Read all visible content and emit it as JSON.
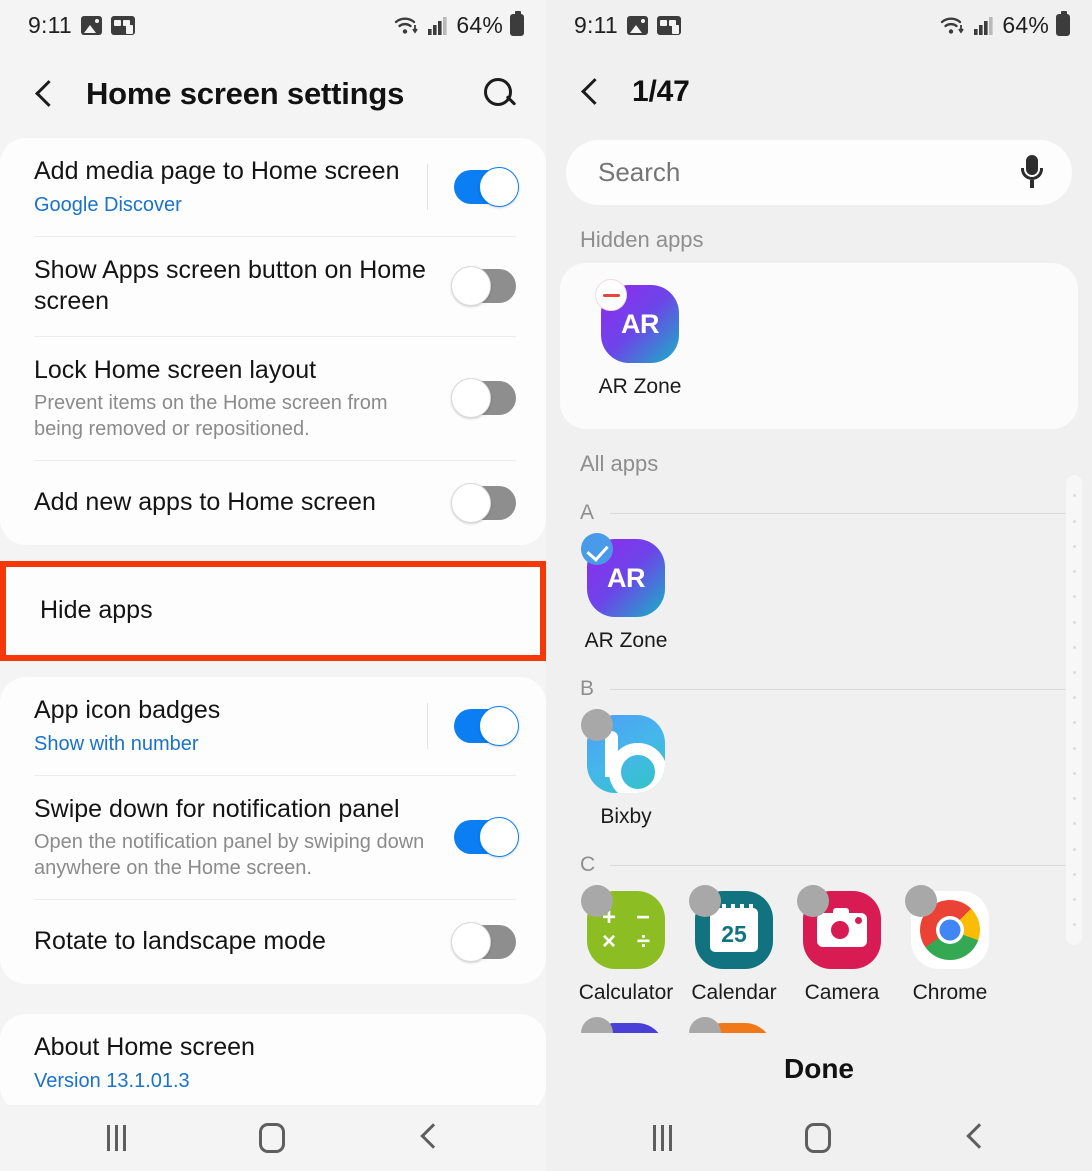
{
  "status_bar": {
    "time": "9:11",
    "battery_percent": "64%",
    "icons": [
      "image-icon",
      "screenshot-icon",
      "wifi-icon",
      "signal-icon",
      "battery-icon"
    ]
  },
  "left_panel": {
    "header": {
      "title": "Home screen settings",
      "back_icon": "back-chevron-icon",
      "search_icon": "search-icon"
    },
    "groups": [
      {
        "rows": [
          {
            "title": "Add media page to Home screen",
            "subtitle": "Google Discover",
            "subtitle_style": "blue",
            "toggle": "on"
          },
          {
            "title": "Show Apps screen button on Home screen",
            "subtitle": "",
            "subtitle_style": "",
            "toggle": "off"
          },
          {
            "title": "Lock Home screen layout",
            "subtitle": "Prevent items on the Home screen from being removed or repositioned.",
            "subtitle_style": "grey",
            "toggle": "off"
          },
          {
            "title": "Add new apps to Home screen",
            "subtitle": "",
            "subtitle_style": "",
            "toggle": "off"
          }
        ]
      }
    ],
    "highlighted_row": {
      "title": "Hide apps",
      "highlight_color": "#f4380a"
    },
    "groups2": [
      {
        "title": "App icon badges",
        "subtitle": "Show with number",
        "subtitle_style": "blue",
        "toggle": "on"
      },
      {
        "title": "Swipe down for notification panel",
        "subtitle": "Open the notification panel by swiping down anywhere on the Home screen.",
        "subtitle_style": "grey",
        "toggle": "on"
      },
      {
        "title": "Rotate to landscape mode",
        "subtitle": "",
        "subtitle_style": "",
        "toggle": "off"
      }
    ],
    "about": {
      "title": "About Home screen",
      "subtitle": "Version 13.1.01.3",
      "subtitle_style": "blue"
    }
  },
  "right_panel": {
    "header": {
      "title": "1/47",
      "back_icon": "back-chevron-icon"
    },
    "search": {
      "placeholder": "Search",
      "mic_icon": "microphone-icon"
    },
    "hidden_apps": {
      "label": "Hidden apps",
      "apps": [
        {
          "name": "AR Zone",
          "icon": "ar-zone-icon",
          "badge": "minus"
        }
      ]
    },
    "all_apps": {
      "label": "All apps",
      "sections": [
        {
          "letter": "A",
          "apps": [
            {
              "name": "AR Zone",
              "icon": "ar-zone-icon",
              "badge": "check"
            }
          ]
        },
        {
          "letter": "B",
          "apps": [
            {
              "name": "Bixby",
              "icon": "bixby-icon",
              "badge": "grey"
            }
          ]
        },
        {
          "letter": "C",
          "apps": [
            {
              "name": "Calculator",
              "icon": "calculator-icon",
              "badge": "grey"
            },
            {
              "name": "Calendar",
              "icon": "calendar-icon",
              "badge": "grey",
              "day": "25"
            },
            {
              "name": "Camera",
              "icon": "camera-icon",
              "badge": "grey"
            },
            {
              "name": "Chrome",
              "icon": "chrome-icon",
              "badge": "grey"
            }
          ]
        }
      ]
    },
    "done_button": "Done"
  },
  "nav_bar": {
    "recent_icon": "recent-apps-icon",
    "home_icon": "home-icon",
    "back_icon": "back-icon"
  },
  "colors": {
    "accent_blue": "#0b7ef4",
    "link_blue": "#1a73c8",
    "highlight_red": "#f4380a"
  }
}
